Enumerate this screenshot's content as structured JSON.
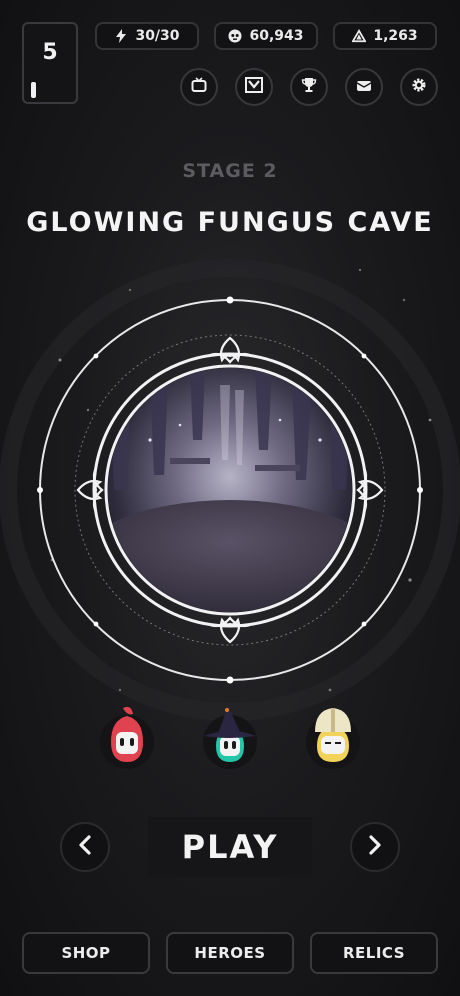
{
  "level": {
    "number": "5",
    "progress": 0.1
  },
  "resources": {
    "energy": {
      "icon": "lightning-icon",
      "value": "30/30"
    },
    "coins": {
      "icon": "skull-coin-icon",
      "value": "60,943"
    },
    "gems": {
      "icon": "pyramid-icon",
      "value": "1,263"
    }
  },
  "menu_icons": [
    "tv-icon",
    "quest-banner-icon",
    "trophy-icon",
    "mail-icon",
    "gear-icon"
  ],
  "stage": {
    "label": "STAGE 2",
    "name": "GLOWING FUNGUS CAVE"
  },
  "heroes": [
    {
      "name": "red-hooded-hero",
      "color": "#e0434f"
    },
    {
      "name": "witch-hat-hero",
      "color": "#23c7a7"
    },
    {
      "name": "helmet-hero",
      "color": "#f2d35a"
    }
  ],
  "controls": {
    "play": "PLAY",
    "prev_icon": "chevron-left-icon",
    "next_icon": "chevron-right-icon"
  },
  "nav": {
    "shop": "SHOP",
    "heroes": "HEROES",
    "relics": "RELICS"
  }
}
